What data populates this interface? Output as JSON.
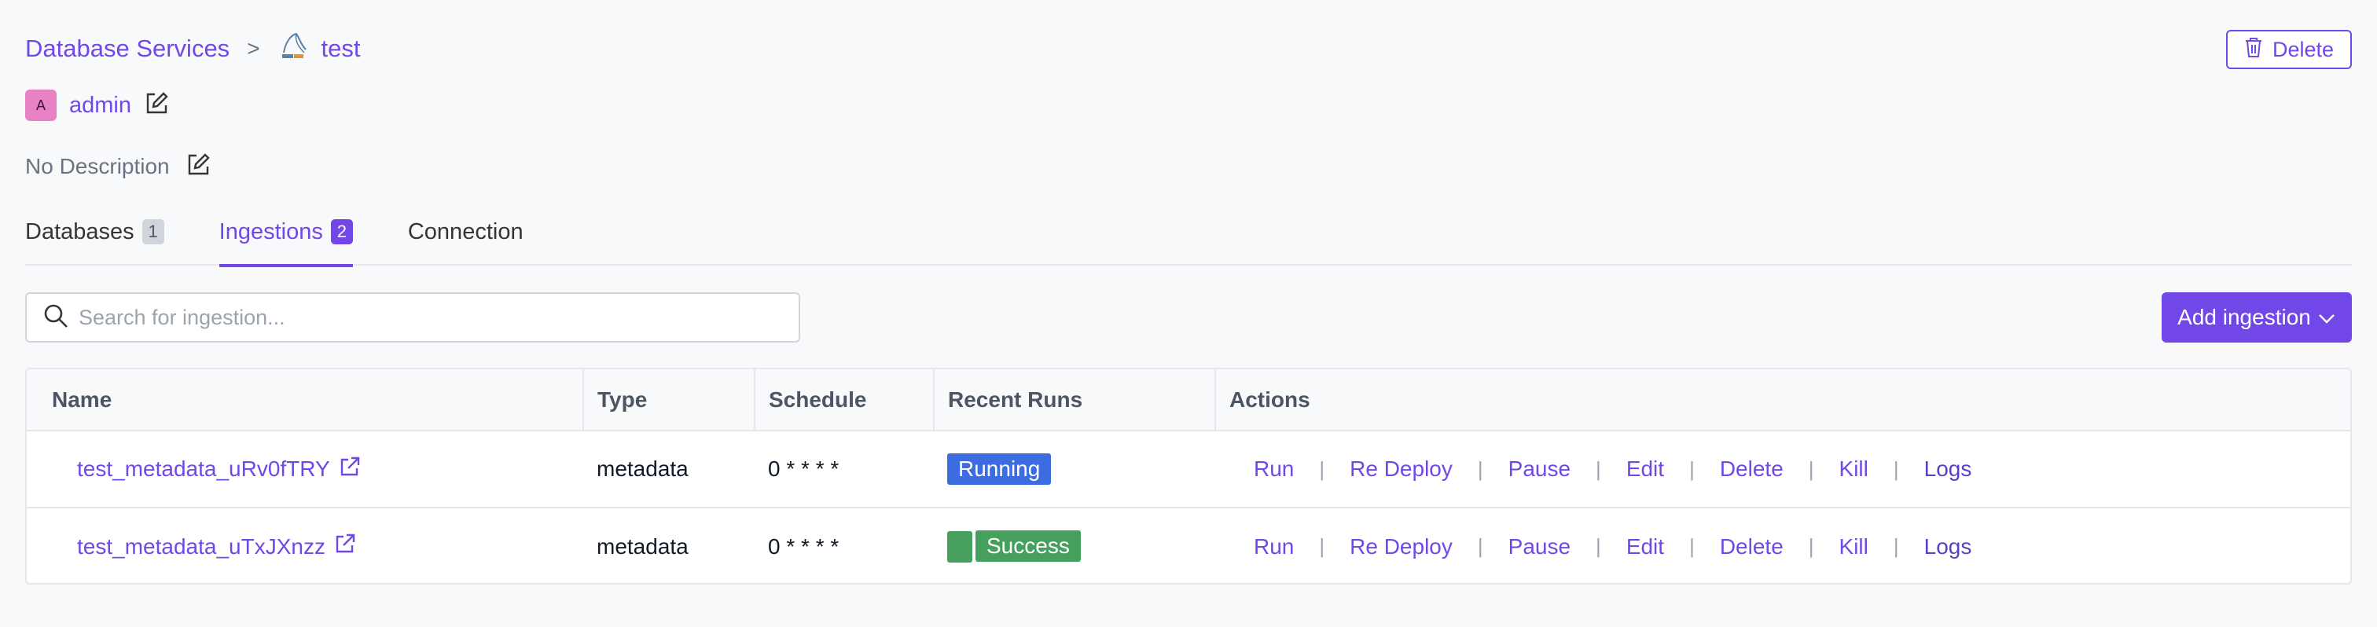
{
  "breadcrumb": {
    "parent": "Database Services",
    "separator": ">",
    "service_name": "test",
    "service_logo_icon": "mysql-logo-icon"
  },
  "header": {
    "delete_label": "Delete"
  },
  "owner": {
    "avatar_initial": "A",
    "name": "admin"
  },
  "description": {
    "text": "No Description"
  },
  "tabs": [
    {
      "label": "Databases",
      "count": "1",
      "active": false
    },
    {
      "label": "Ingestions",
      "count": "2",
      "active": true
    },
    {
      "label": "Connection",
      "count": null,
      "active": false
    }
  ],
  "search": {
    "placeholder": "Search for ingestion...",
    "value": ""
  },
  "toolbar": {
    "add_label": "Add ingestion"
  },
  "table": {
    "columns": [
      "Name",
      "Type",
      "Schedule",
      "Recent Runs",
      "Actions"
    ],
    "rows": [
      {
        "name": "test_metadata_uRv0fTRY",
        "type": "metadata",
        "schedule": "0 * * * *",
        "recent_run": "Running",
        "status": "running"
      },
      {
        "name": "test_metadata_uTxJXnzz",
        "type": "metadata",
        "schedule": "0 * * * *",
        "recent_run": "Success",
        "status": "success"
      }
    ],
    "actions": [
      "Run",
      "Re Deploy",
      "Pause",
      "Edit",
      "Delete",
      "Kill",
      "Logs"
    ],
    "action_separator": "|"
  },
  "colors": {
    "accent": "#7147e8",
    "running": "#3b6ce0",
    "success": "#45a05d",
    "avatar": "#e982c5"
  }
}
